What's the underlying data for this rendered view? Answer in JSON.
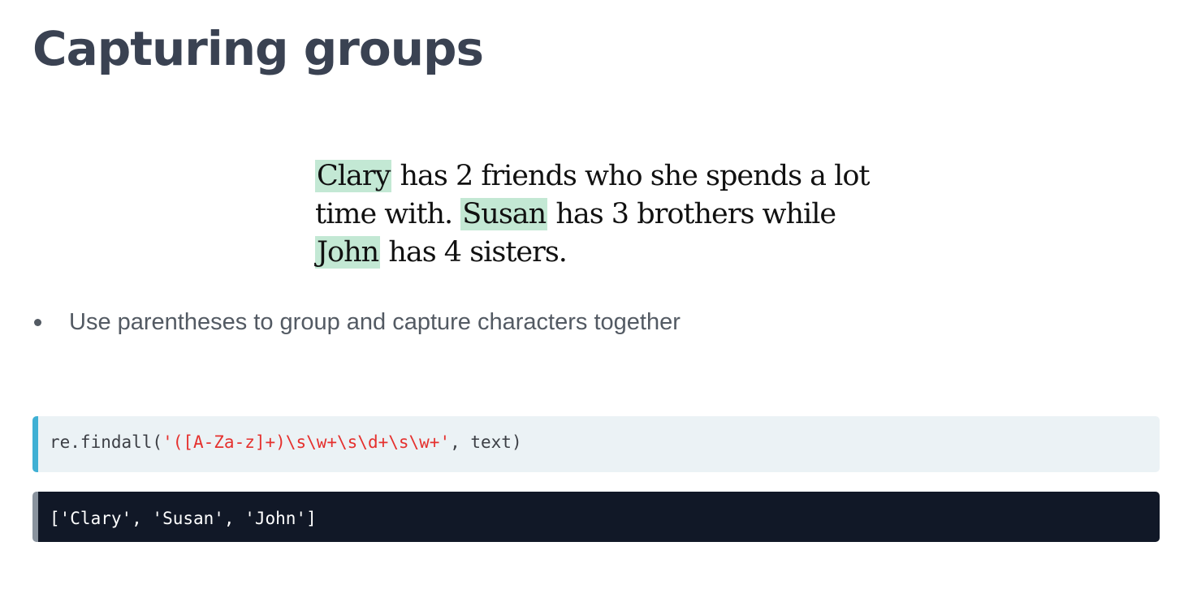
{
  "slide": {
    "title": "Capturing groups"
  },
  "example": {
    "line1": {
      "highlight": "Clary",
      "rest": " has 2 friends who she spends a lot"
    },
    "line2": {
      "before": "time with. ",
      "highlight": "Susan",
      "rest": " has 3 brothers while"
    },
    "line3": {
      "highlight": "John",
      "rest": " has 4 sisters."
    },
    "highlight_color": "#c3e8d4"
  },
  "bullets": [
    "Use parentheses to group and capture characters together"
  ],
  "code": {
    "prefix": "re.findall(",
    "pattern": "'([A-Za-z]+)\\s\\w+\\s\\d+\\s\\w+'",
    "suffix": ", text)",
    "accent_color": "#3fb0d4",
    "string_color": "#e5312e"
  },
  "output": {
    "text": "['Clary', 'Susan', 'John']",
    "background": "#111827"
  }
}
